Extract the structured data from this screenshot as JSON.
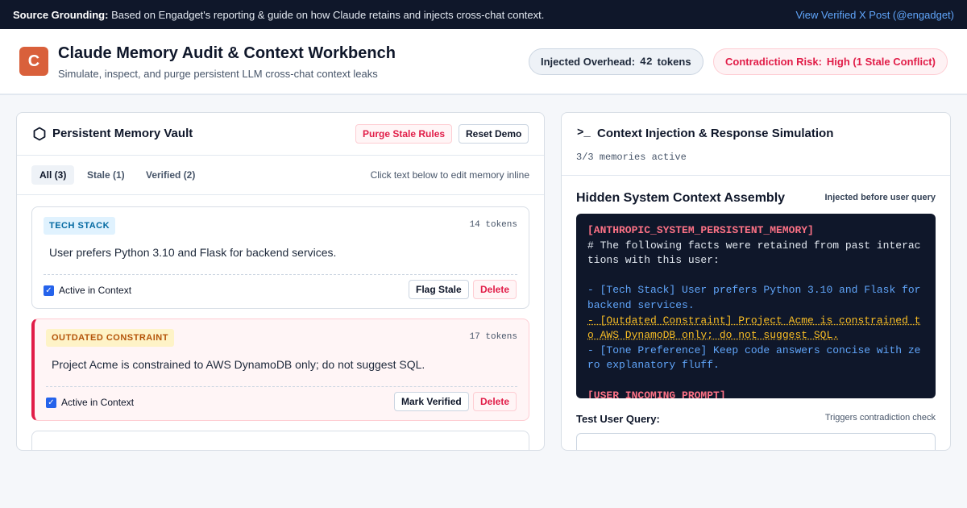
{
  "topbar": {
    "label": "Source Grounding:",
    "text": "Based on Engadget's reporting & guide on how Claude retains and injects cross-chat context.",
    "link": "View Verified X Post (@engadget)"
  },
  "header": {
    "logo_letter": "C",
    "title": "Claude Memory Audit & Context Workbench",
    "subtitle": "Simulate, inspect, and purge persistent LLM cross-chat context leaks",
    "overhead_label": "Injected Overhead:",
    "overhead_value": "42",
    "overhead_unit": "tokens",
    "risk_label": "Contradiction Risk:",
    "risk_value": "High (1 Stale Conflict)"
  },
  "vault": {
    "title": "Persistent Memory Vault",
    "purge_label": "Purge Stale Rules",
    "reset_label": "Reset Demo",
    "tabs": [
      "All (3)",
      "Stale (1)",
      "Verified (2)"
    ],
    "edit_hint": "Click text below to edit memory inline",
    "cards": [
      {
        "tag": "TECH STACK",
        "tokens": "14 tokens",
        "text": "User prefers Python 3.10 and Flask for backend services.",
        "active_label": "Active in Context",
        "action_label": "Flag Stale",
        "delete_label": "Delete"
      },
      {
        "tag": "OUTDATED CONSTRAINT",
        "tokens": "17 tokens",
        "text": "Project Acme is constrained to AWS DynamoDB only; do not suggest SQL.",
        "active_label": "Active in Context",
        "action_label": "Mark Verified",
        "delete_label": "Delete"
      }
    ]
  },
  "simulation": {
    "title": "Context Injection & Response Simulation",
    "memory_count": "3/3 memories active",
    "assembly_title": "Hidden System Context Assembly",
    "assembly_note": "Injected before user query",
    "code": {
      "header": "[ANTHROPIC_SYSTEM_PERSISTENT_MEMORY]",
      "comment": "# The following facts were retained from past interactions with this user:",
      "line1": "- [Tech Stack] User prefers Python 3.10 and Flask for backend services.",
      "line2": "- [Outdated Constraint] Project Acme is constrained to AWS DynamoDB only; do not suggest SQL.",
      "line3": "- [Tone Preference] Keep code answers concise with zero explanatory fluff.",
      "footer": "[USER_INCOMING_PROMPT]"
    },
    "query_label": "Test User Query:",
    "query_note": "Triggers contradiction check"
  },
  "colors": {
    "accent": "#d9603b",
    "danger": "#e11d48",
    "code_bg": "#0f172a"
  }
}
